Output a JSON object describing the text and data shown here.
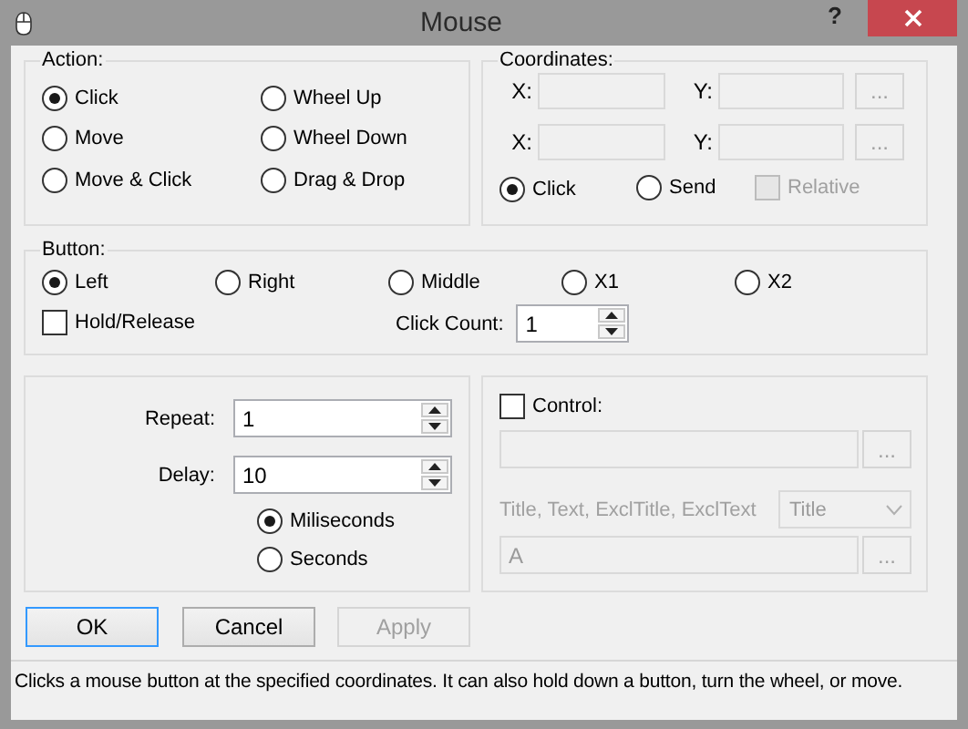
{
  "window": {
    "title": "Mouse",
    "help": "?"
  },
  "action": {
    "label": "Action:",
    "options": [
      {
        "label": "Click",
        "selected": true
      },
      {
        "label": "Wheel Up",
        "selected": false
      },
      {
        "label": "Move",
        "selected": false
      },
      {
        "label": "Wheel Down",
        "selected": false
      },
      {
        "label": "Move & Click",
        "selected": false
      },
      {
        "label": "Drag & Drop",
        "selected": false
      }
    ]
  },
  "coordinates": {
    "label": "Coordinates:",
    "fields_disabled": true,
    "rows": [
      {
        "x_label": "X:",
        "y_label": "Y:",
        "browse": "..."
      },
      {
        "x_label": "X:",
        "y_label": "Y:",
        "browse": "..."
      }
    ],
    "modes": [
      {
        "label": "Click",
        "selected": true
      },
      {
        "label": "Send",
        "selected": false
      }
    ],
    "relative": {
      "label": "Relative",
      "checked": false,
      "disabled": true
    }
  },
  "button": {
    "label": "Button:",
    "options": [
      {
        "label": "Left",
        "selected": true
      },
      {
        "label": "Right",
        "selected": false
      },
      {
        "label": "Middle",
        "selected": false
      },
      {
        "label": "X1",
        "selected": false
      },
      {
        "label": "X2",
        "selected": false
      }
    ],
    "hold_release": {
      "label": "Hold/Release",
      "checked": false
    },
    "click_count": {
      "label": "Click Count:",
      "value": "1"
    }
  },
  "timing": {
    "repeat": {
      "label": "Repeat:",
      "value": "1"
    },
    "delay": {
      "label": "Delay:",
      "value": "10"
    },
    "units": [
      {
        "label": "Miliseconds",
        "selected": true
      },
      {
        "label": "Seconds",
        "selected": false
      }
    ]
  },
  "control": {
    "checkbox": {
      "label": "Control:",
      "checked": false
    },
    "disabled": true,
    "control_browse": "...",
    "match_label": "Title, Text, ExclTitle, ExclText",
    "match_mode": "Title",
    "text_value": "A",
    "text_browse": "..."
  },
  "buttons": [
    {
      "label": "OK",
      "default": true,
      "disabled": false
    },
    {
      "label": "Cancel",
      "default": false,
      "disabled": false
    },
    {
      "label": "Apply",
      "default": false,
      "disabled": true
    }
  ],
  "status_bar": "Clicks a mouse button at the specified coordinates. It can also hold down a button, turn the wheel, or move."
}
